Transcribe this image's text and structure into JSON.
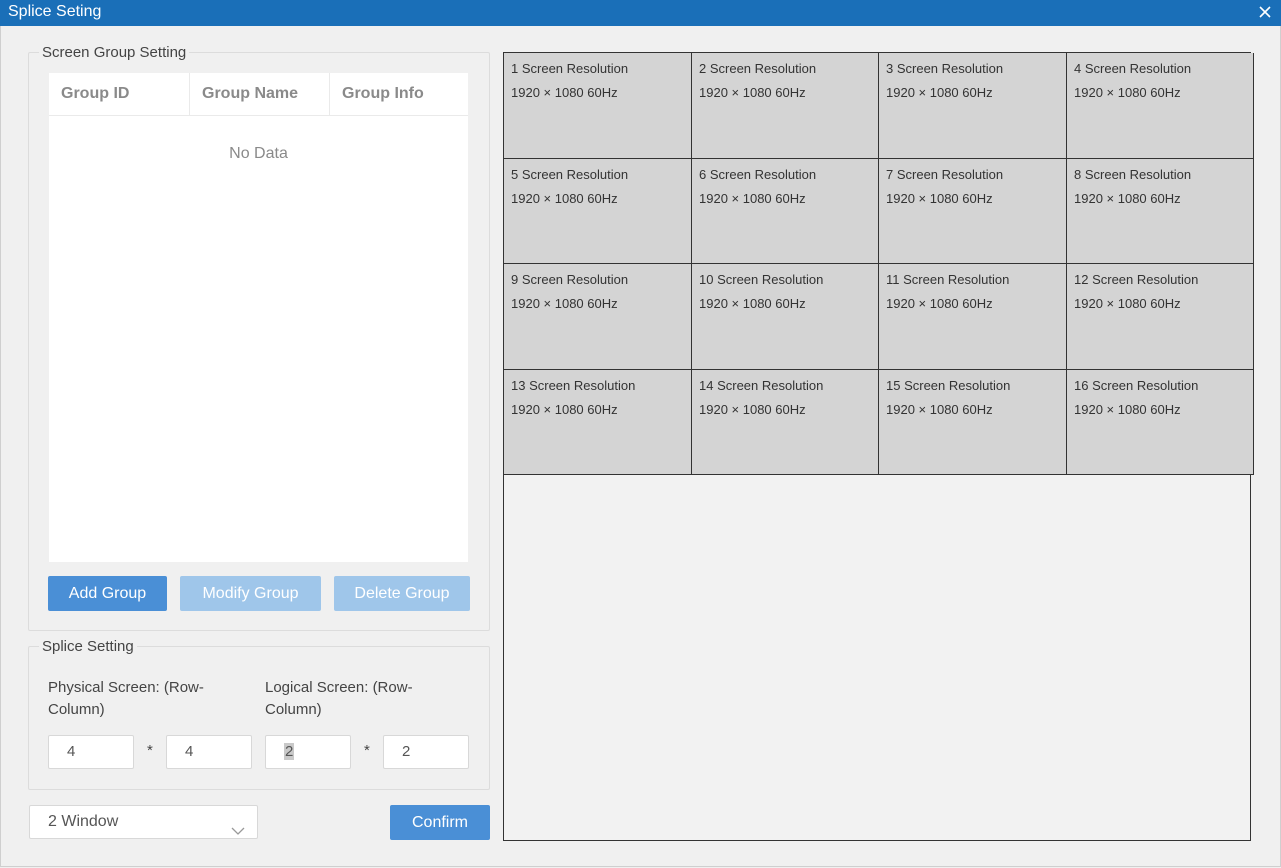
{
  "window": {
    "title": "Splice Seting"
  },
  "group_setting": {
    "legend": "Screen Group Setting",
    "columns": [
      "Group ID",
      "Group Name",
      "Group Info"
    ],
    "empty_text": "No Data",
    "add_label": "Add Group",
    "modify_label": "Modify Group",
    "delete_label": "Delete Group"
  },
  "splice_setting": {
    "legend": "Splice Setting",
    "physical_label": "Physical Screen: (Row-Column)",
    "logical_label": "Logical Screen: (Row-Column)",
    "physical_row": "4",
    "physical_col": "4",
    "logical_row": "2",
    "logical_col": "2",
    "separator": "*"
  },
  "window_select": {
    "value": "2 Window"
  },
  "confirm_label": "Confirm",
  "screens": [
    {
      "name": "1 Screen Resolution",
      "res": "1920 × 1080 60Hz"
    },
    {
      "name": "2 Screen Resolution",
      "res": "1920 × 1080 60Hz"
    },
    {
      "name": "3 Screen Resolution",
      "res": "1920 × 1080 60Hz"
    },
    {
      "name": "4 Screen Resolution",
      "res": "1920 × 1080 60Hz"
    },
    {
      "name": "5 Screen Resolution",
      "res": "1920 × 1080 60Hz"
    },
    {
      "name": "6 Screen Resolution",
      "res": "1920 × 1080 60Hz"
    },
    {
      "name": "7 Screen Resolution",
      "res": "1920 × 1080 60Hz"
    },
    {
      "name": "8 Screen Resolution",
      "res": "1920 × 1080 60Hz"
    },
    {
      "name": "9 Screen Resolution",
      "res": "1920 × 1080 60Hz"
    },
    {
      "name": "10 Screen Resolution",
      "res": "1920 × 1080 60Hz"
    },
    {
      "name": "11 Screen Resolution",
      "res": "1920 × 1080 60Hz"
    },
    {
      "name": "12 Screen Resolution",
      "res": "1920 × 1080 60Hz"
    },
    {
      "name": "13 Screen Resolution",
      "res": "1920 × 1080 60Hz"
    },
    {
      "name": "14 Screen Resolution",
      "res": "1920 × 1080 60Hz"
    },
    {
      "name": "15 Screen Resolution",
      "res": "1920 × 1080 60Hz"
    },
    {
      "name": "16 Screen Resolution",
      "res": "1920 × 1080 60Hz"
    }
  ],
  "colors": {
    "titlebar": "#1a6fb8",
    "primary_button": "#4a8fd6",
    "disabled_button": "#9fc6ea",
    "screen_cell": "#d4d4d4"
  },
  "icons": {
    "close": "close-icon",
    "dropdown": "chevron-down-icon"
  }
}
